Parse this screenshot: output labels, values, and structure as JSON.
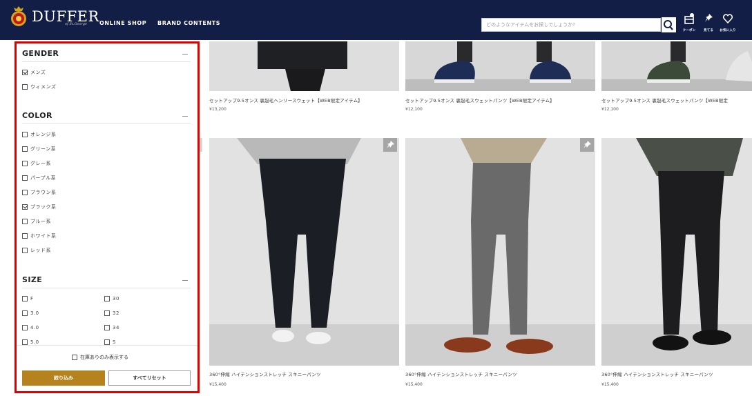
{
  "header": {
    "logo_text": "DUFFER",
    "logo_sub": "of St.George",
    "nav": [
      "ONLINE SHOP",
      "BRAND CONTENTS"
    ],
    "search_placeholder": "どのようなアイテムをお探しでしょうか?",
    "icons": [
      {
        "name": "coupon-icon",
        "label": "クーポン"
      },
      {
        "name": "pin-icon",
        "label": "見てる"
      },
      {
        "name": "heart-icon",
        "label": "お気に入り"
      }
    ]
  },
  "filter": {
    "gender": {
      "title": "GENDER",
      "items": [
        {
          "label": "メンズ",
          "checked": true
        },
        {
          "label": "ウィメンズ",
          "checked": false
        }
      ]
    },
    "color": {
      "title": "COLOR",
      "items": [
        {
          "label": "オレンジ系",
          "checked": false
        },
        {
          "label": "グリーン系",
          "checked": false
        },
        {
          "label": "グレー系",
          "checked": false
        },
        {
          "label": "パープル系",
          "checked": false
        },
        {
          "label": "ブラウン系",
          "checked": false
        },
        {
          "label": "ブラック系",
          "checked": true
        },
        {
          "label": "ブルー系",
          "checked": false
        },
        {
          "label": "ホワイト系",
          "checked": false
        },
        {
          "label": "レッド系",
          "checked": false
        }
      ]
    },
    "size": {
      "title": "SIZE",
      "items": [
        {
          "label": "F",
          "checked": false
        },
        {
          "label": "30",
          "checked": false
        },
        {
          "label": "3.0",
          "checked": false
        },
        {
          "label": "32",
          "checked": false
        },
        {
          "label": "4.0",
          "checked": false
        },
        {
          "label": "34",
          "checked": false
        },
        {
          "label": "5.0",
          "checked": false
        },
        {
          "label": "S",
          "checked": false
        }
      ]
    },
    "in_stock_label": "在庫ありのみ表示する",
    "apply_label": "絞り込み",
    "reset_label": "すべてリセット"
  },
  "products": {
    "row1": [
      {
        "name": "セットアップ9.5オンス 裏起毛ヘンリースウェット【WEB限定アイテム】",
        "price": "¥13,200"
      },
      {
        "name": "セットアップ9.5オンス 裏起毛スウェットパンツ【WEB限定アイテム】",
        "price": "¥12,100"
      },
      {
        "name": "セットアップ9.5オンス 裏起毛スウェットパンツ【WEB限定",
        "price": "¥12,100"
      }
    ],
    "row2": [
      {
        "name": "360°伸縮 ハイテンションストレッチ スキニーパンツ",
        "price": "¥15,400"
      },
      {
        "name": "360°伸縮 ハイテンションストレッチ スキニーパンツ",
        "price": "¥15,400"
      },
      {
        "name": "360°伸縮 ハイテンションストレッチ スキニーパンツ",
        "price": "¥15,400"
      }
    ]
  },
  "colors": {
    "header_bg": "#131e47",
    "highlight_border": "#e00000",
    "apply_button": "#b5821e"
  }
}
